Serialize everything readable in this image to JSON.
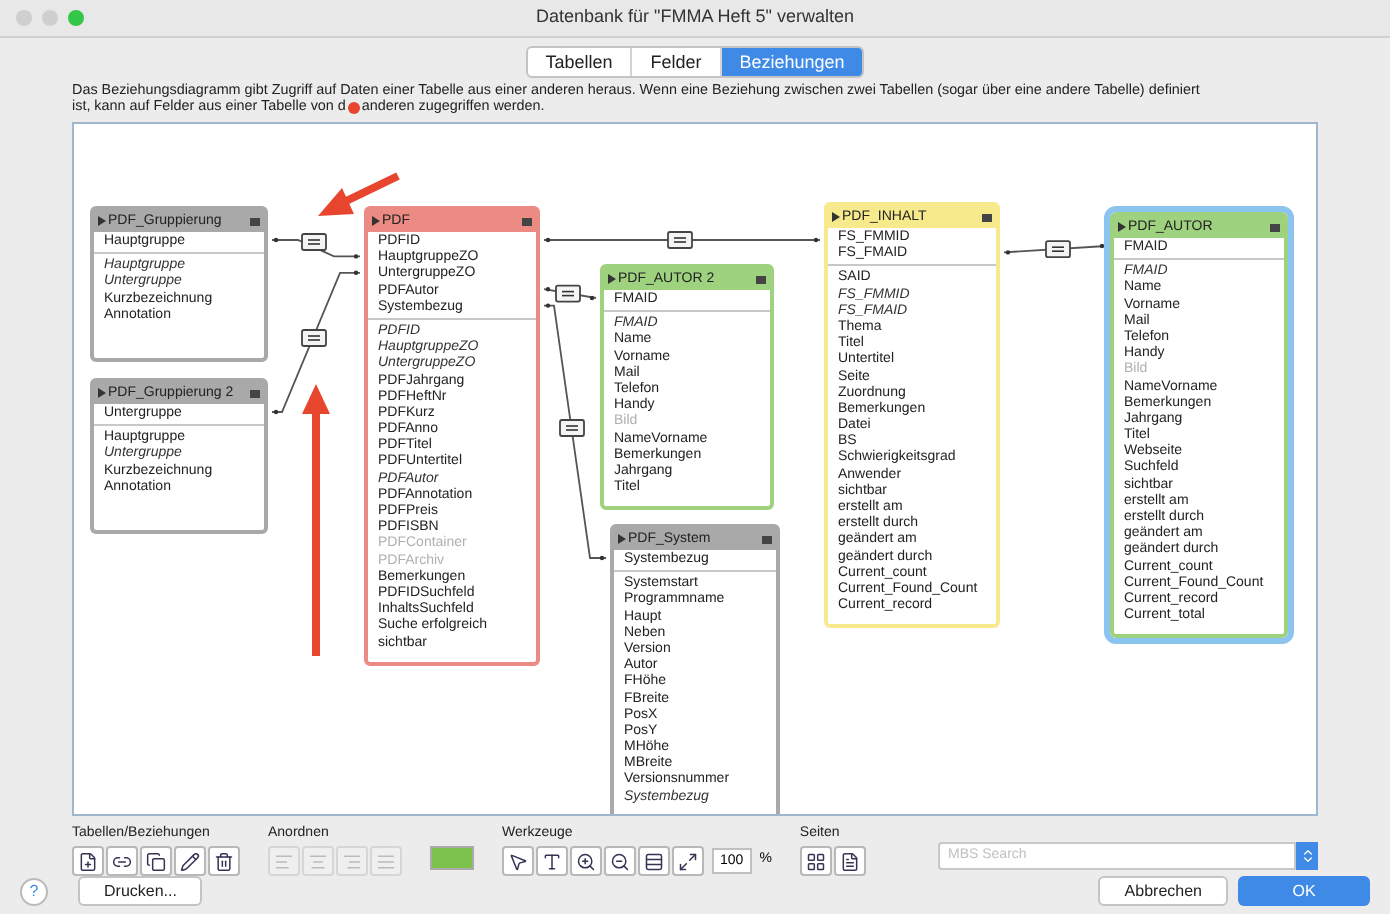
{
  "window": {
    "title": "Datenbank für \"FMMA Heft 5\" verwalten"
  },
  "tabs": [
    {
      "label": "Tabellen",
      "selected": false
    },
    {
      "label": "Felder",
      "selected": false
    },
    {
      "label": "Beziehungen",
      "selected": true
    }
  ],
  "description": {
    "line_1": "Das Beziehungsdiagramm gibt Zugriff auf Daten einer Tabelle aus einer anderen heraus. Wenn eine Beziehung zwischen zwei Tabellen (sogar über eine andere Tabelle) definiert",
    "before_mark": "ist, kann auf Felder aus einer Tabelle von d",
    "after_mark": "anderen zugegriffen werden."
  },
  "tables": [
    {
      "name": "PDF_Gruppierung",
      "color": "#a9a9a9",
      "selected": false,
      "keys": [
        {
          "name": "Hauptgruppe"
        }
      ],
      "fields": [
        {
          "name": "Hauptgruppe",
          "kind": "italic"
        },
        {
          "name": "Untergruppe",
          "kind": "italic"
        },
        {
          "name": "Kurzbezeichnung",
          "kind": "normal"
        },
        {
          "name": "Annotation",
          "kind": "normal"
        }
      ]
    },
    {
      "name": "PDF_Gruppierung 2",
      "color": "#a9a9a9",
      "selected": false,
      "keys": [
        {
          "name": "Untergruppe"
        }
      ],
      "fields": [
        {
          "name": "Hauptgruppe",
          "kind": "normal"
        },
        {
          "name": "Untergruppe",
          "kind": "italic"
        },
        {
          "name": "Kurzbezeichnung",
          "kind": "normal"
        },
        {
          "name": "Annotation",
          "kind": "normal"
        }
      ]
    },
    {
      "name": "PDF",
      "color": "#ec8a84",
      "selected": false,
      "keys": [
        {
          "name": "PDFID"
        },
        {
          "name": "HauptgruppeZO"
        },
        {
          "name": "UntergruppeZO"
        },
        {
          "name": "PDFAutor"
        },
        {
          "name": "Systembezug"
        }
      ],
      "fields": [
        {
          "name": "PDFID",
          "kind": "italic"
        },
        {
          "name": "HauptgruppeZO",
          "kind": "italic"
        },
        {
          "name": "UntergruppeZO",
          "kind": "italic"
        },
        {
          "name": "PDFJahrgang",
          "kind": "normal"
        },
        {
          "name": "PDFHeftNr",
          "kind": "normal"
        },
        {
          "name": "PDFKurz",
          "kind": "normal"
        },
        {
          "name": "PDFAnno",
          "kind": "normal"
        },
        {
          "name": "PDFTitel",
          "kind": "normal"
        },
        {
          "name": "PDFUntertitel",
          "kind": "normal"
        },
        {
          "name": "PDFAutor",
          "kind": "italic"
        },
        {
          "name": "PDFAnnotation",
          "kind": "normal"
        },
        {
          "name": "PDFPreis",
          "kind": "normal"
        },
        {
          "name": "PDFISBN",
          "kind": "normal"
        },
        {
          "name": "PDFContainer",
          "kind": "disabled"
        },
        {
          "name": "PDFArchiv",
          "kind": "disabled"
        },
        {
          "name": "Bemerkungen",
          "kind": "normal"
        },
        {
          "name": "PDFIDSuchfeld",
          "kind": "normal"
        },
        {
          "name": "InhaltsSuchfeld",
          "kind": "normal"
        },
        {
          "name": "Suche erfolgreich",
          "kind": "normal"
        },
        {
          "name": "sichtbar",
          "kind": "normal"
        }
      ]
    },
    {
      "name": "PDF_AUTOR 2",
      "color": "#9fd27f",
      "selected": false,
      "keys": [
        {
          "name": "FMAID"
        }
      ],
      "fields": [
        {
          "name": "FMAID",
          "kind": "italic"
        },
        {
          "name": "Name",
          "kind": "normal"
        },
        {
          "name": "Vorname",
          "kind": "normal"
        },
        {
          "name": "Mail",
          "kind": "normal"
        },
        {
          "name": "Telefon",
          "kind": "normal"
        },
        {
          "name": "Handy",
          "kind": "normal"
        },
        {
          "name": "Bild",
          "kind": "disabled"
        },
        {
          "name": "NameVorname",
          "kind": "normal"
        },
        {
          "name": "Bemerkungen",
          "kind": "normal"
        },
        {
          "name": "Jahrgang",
          "kind": "normal"
        },
        {
          "name": "Titel",
          "kind": "normal"
        }
      ]
    },
    {
      "name": "PDF_System",
      "color": "#a9a9a9",
      "selected": false,
      "keys": [
        {
          "name": "Systembezug"
        }
      ],
      "fields": [
        {
          "name": "Systemstart",
          "kind": "normal"
        },
        {
          "name": "Programmname",
          "kind": "normal"
        },
        {
          "name": "Haupt",
          "kind": "normal"
        },
        {
          "name": "Neben",
          "kind": "normal"
        },
        {
          "name": "Version",
          "kind": "normal"
        },
        {
          "name": "Autor",
          "kind": "normal"
        },
        {
          "name": "FHöhe",
          "kind": "normal"
        },
        {
          "name": "FBreite",
          "kind": "normal"
        },
        {
          "name": "PosX",
          "kind": "normal"
        },
        {
          "name": "PosY",
          "kind": "normal"
        },
        {
          "name": "MHöhe",
          "kind": "normal"
        },
        {
          "name": "MBreite",
          "kind": "normal"
        },
        {
          "name": "Versionsnummer",
          "kind": "normal"
        },
        {
          "name": "Systembezug",
          "kind": "italic"
        }
      ]
    },
    {
      "name": "PDF_INHALT",
      "color": "#f6ea8c",
      "selected": false,
      "keys": [
        {
          "name": "FS_FMMID"
        },
        {
          "name": "FS_FMAID"
        }
      ],
      "fields": [
        {
          "name": "SAID",
          "kind": "normal"
        },
        {
          "name": "FS_FMMID",
          "kind": "italic"
        },
        {
          "name": "FS_FMAID",
          "kind": "italic"
        },
        {
          "name": "Thema",
          "kind": "normal"
        },
        {
          "name": "Titel",
          "kind": "normal"
        },
        {
          "name": "Untertitel",
          "kind": "normal"
        },
        {
          "name": "Seite",
          "kind": "normal"
        },
        {
          "name": "Zuordnung",
          "kind": "normal"
        },
        {
          "name": "Bemerkungen",
          "kind": "normal"
        },
        {
          "name": "Datei",
          "kind": "normal"
        },
        {
          "name": "BS",
          "kind": "normal"
        },
        {
          "name": "Schwierigkeitsgrad",
          "kind": "normal"
        },
        {
          "name": "Anwender",
          "kind": "normal"
        },
        {
          "name": "sichtbar",
          "kind": "normal"
        },
        {
          "name": "erstellt am",
          "kind": "normal"
        },
        {
          "name": "erstellt durch",
          "kind": "normal"
        },
        {
          "name": "geändert am",
          "kind": "normal"
        },
        {
          "name": "geändert durch",
          "kind": "normal"
        },
        {
          "name": "Current_count",
          "kind": "normal"
        },
        {
          "name": "Current_Found_Count",
          "kind": "normal"
        },
        {
          "name": "Current_record",
          "kind": "normal"
        }
      ]
    },
    {
      "name": "PDF_AUTOR",
      "color": "#9fd27f",
      "selected": true,
      "keys": [
        {
          "name": "FMAID"
        }
      ],
      "fields": [
        {
          "name": "FMAID",
          "kind": "italic"
        },
        {
          "name": "Name",
          "kind": "normal"
        },
        {
          "name": "Vorname",
          "kind": "normal"
        },
        {
          "name": "Mail",
          "kind": "normal"
        },
        {
          "name": "Telefon",
          "kind": "normal"
        },
        {
          "name": "Handy",
          "kind": "normal"
        },
        {
          "name": "Bild",
          "kind": "disabled"
        },
        {
          "name": "NameVorname",
          "kind": "normal"
        },
        {
          "name": "Bemerkungen",
          "kind": "normal"
        },
        {
          "name": "Jahrgang",
          "kind": "normal"
        },
        {
          "name": "Titel",
          "kind": "normal"
        },
        {
          "name": "Webseite",
          "kind": "normal"
        },
        {
          "name": "Suchfeld",
          "kind": "normal"
        },
        {
          "name": "sichtbar",
          "kind": "normal"
        },
        {
          "name": "erstellt am",
          "kind": "normal"
        },
        {
          "name": "erstellt durch",
          "kind": "normal"
        },
        {
          "name": "geändert am",
          "kind": "normal"
        },
        {
          "name": "geändert durch",
          "kind": "normal"
        },
        {
          "name": "Current_count",
          "kind": "normal"
        },
        {
          "name": "Current_Found_Count",
          "kind": "normal"
        },
        {
          "name": "Current_record",
          "kind": "normal"
        },
        {
          "name": "Current_total",
          "kind": "normal"
        }
      ]
    }
  ],
  "toolbar": {
    "groups": [
      {
        "label": "Tabellen/Beziehungen",
        "kind": "tables",
        "disabled": false
      },
      {
        "label": "Anordnen",
        "kind": "arrange",
        "disabled": true
      },
      {
        "label": "Werkzeuge",
        "kind": "tools",
        "disabled": false
      },
      {
        "label": "Seiten",
        "kind": "pages",
        "disabled": false
      }
    ],
    "swatch": {
      "color": "#7cc24c"
    },
    "zoom": {
      "value": "100",
      "unit": "%"
    },
    "search": {
      "placeholder": "MBS Search"
    }
  },
  "buttons": {
    "help": "?",
    "print": "Drucken...",
    "cancel": "Abbrechen",
    "ok": "OK"
  }
}
